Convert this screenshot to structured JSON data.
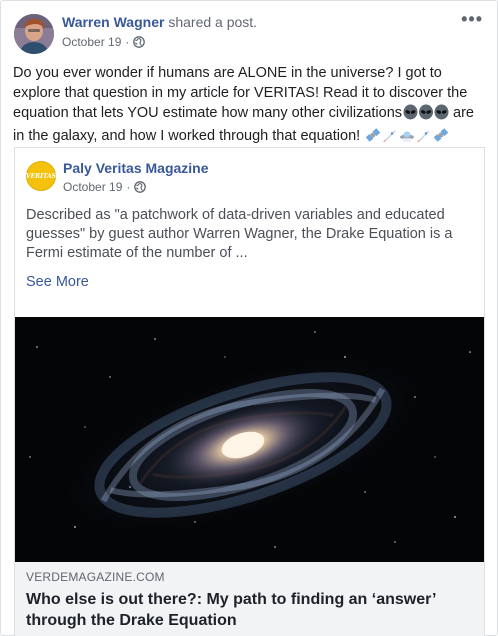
{
  "post": {
    "author": "Warren Wagner",
    "action": "shared a post.",
    "date": "October 19",
    "separator": "·",
    "more_icon": "more-dots-icon",
    "text_main": "Do you ever wonder if humans are ALONE in the universe? I got to explore that question in my article for VERITAS! Read it to discover the equation that lets YOU estimate how many other civilizations",
    "text_mid": " are in the galaxy, and how I worked through that equation! ",
    "emoji_group_1": [
      "alien-icon",
      "alien-icon",
      "alien-icon"
    ],
    "emoji_group_2": [
      "satellite-icon",
      "rocket-icon",
      "ufo-icon",
      "rocket-icon",
      "satellite-icon"
    ]
  },
  "shared": {
    "page_name": "Paly Veritas Magazine",
    "page_avatar_text": "VERITAS",
    "date": "October 19",
    "separator": "·",
    "excerpt": "Described as \"a patchwork of data-driven variables and educated guesses\" by guest author Warren Wagner, the Drake Equation is a Fermi estimate of the number of ...",
    "see_more": "See More",
    "image": "galaxy-spiral-image",
    "link": {
      "domain": "VERDEMAGAZINE.COM",
      "title": "Who else is out there?: My path to finding an ‘answer’ through the Drake Equation"
    }
  },
  "colors": {
    "link_blue": "#385898",
    "meta_gray": "#616770",
    "footer_bg": "#f2f3f5",
    "veritas_yellow": "#f4c20d"
  }
}
